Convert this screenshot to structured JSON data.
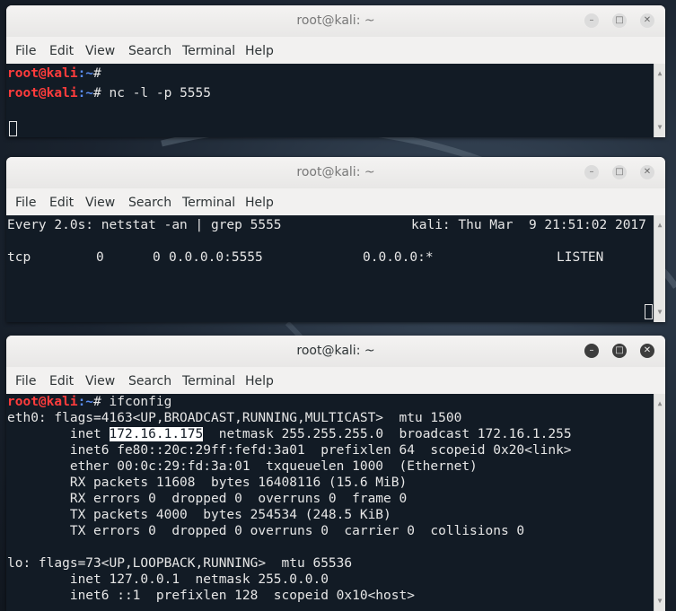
{
  "windows": [
    {
      "title": "root@kali: ~",
      "menu": [
        "File",
        "Edit",
        "View",
        "Search",
        "Terminal",
        "Help"
      ],
      "lines": [
        {
          "user": "root@kali",
          "path": ":~",
          "sym": "#",
          "cmd": ""
        },
        {
          "user": "root@kali",
          "path": ":~",
          "sym": "#",
          "cmd": " nc -l -p 5555"
        }
      ]
    },
    {
      "title": "root@kali: ~",
      "menu": [
        "File",
        "Edit",
        "View",
        "Search",
        "Terminal",
        "Help"
      ],
      "header_left": "Every 2.0s: netstat -an | grep 5555",
      "header_right": "kali: Thu Mar  9 21:51:02 2017",
      "row": {
        "proto": "tcp",
        "recvq": "0",
        "sendq": "0",
        "local": "0.0.0.0:5555",
        "foreign": "0.0.0.0:*",
        "state": "LISTEN"
      }
    },
    {
      "title": "root@kali: ~",
      "menu": [
        "File",
        "Edit",
        "View",
        "Search",
        "Terminal",
        "Help"
      ],
      "prompt": {
        "user": "root@kali",
        "path": ":~",
        "sym": "#",
        "cmd": " ifconfig"
      },
      "inet_prefix": "        inet ",
      "inet_ip": "172.16.1.175",
      "inet_suffix": "  netmask 255.255.255.0  broadcast 172.16.1.255",
      "output": [
        "eth0: flags=4163<UP,BROADCAST,RUNNING,MULTICAST>  mtu 1500",
        "        inet6 fe80::20c:29ff:fefd:3a01  prefixlen 64  scopeid 0x20<link>",
        "        ether 00:0c:29:fd:3a:01  txqueuelen 1000  (Ethernet)",
        "        RX packets 11608  bytes 16408116 (15.6 MiB)",
        "        RX errors 0  dropped 0  overruns 0  frame 0",
        "        TX packets 4000  bytes 254534 (248.5 KiB)",
        "        TX errors 0  dropped 0 overruns 0  carrier 0  collisions 0",
        "",
        "lo: flags=73<UP,LOOPBACK,RUNNING>  mtu 65536",
        "        inet 127.0.0.1  netmask 255.0.0.0",
        "        inet6 ::1  prefixlen 128  scopeid 0x10<host>"
      ]
    }
  ],
  "icons": {
    "minimize": "minimize-icon",
    "maximize": "maximize-icon",
    "close": "close-icon"
  },
  "colors": {
    "terminal_bg": "#121b25",
    "prompt_user": "#ff3c3c",
    "prompt_path": "#5a8cf0"
  }
}
